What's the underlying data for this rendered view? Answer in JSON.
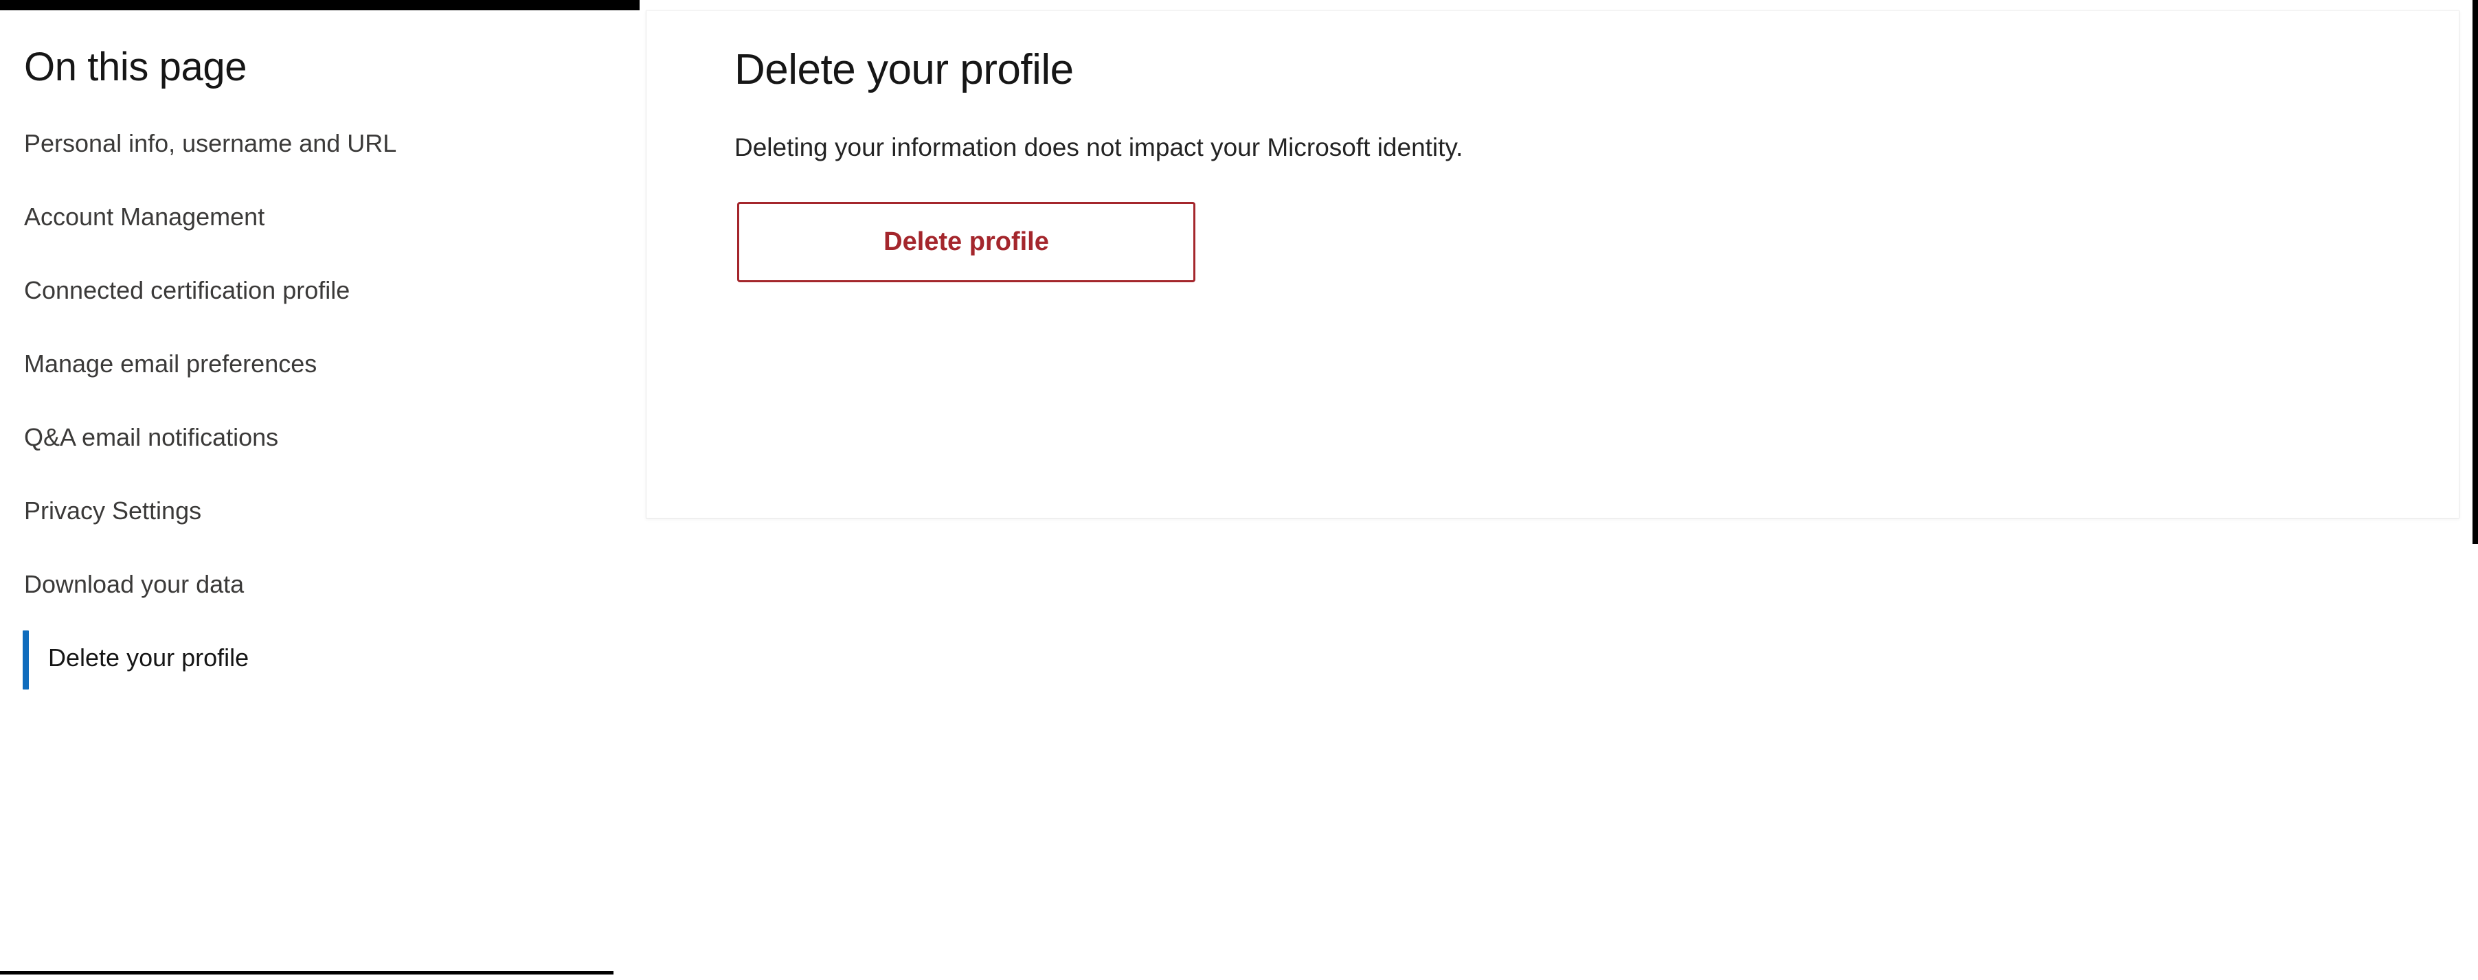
{
  "colors": {
    "accent_blue": "#0F6CBD",
    "danger_red": "#A4262C",
    "text_primary": "#161616",
    "text_secondary": "#3b3a39",
    "card_border": "#ebebeb",
    "black_bar": "#000000"
  },
  "sidebar": {
    "title": "On this page",
    "items": [
      {
        "label": "Personal info, username and URL",
        "active": false
      },
      {
        "label": "Account Management",
        "active": false
      },
      {
        "label": "Connected certification profile",
        "active": false
      },
      {
        "label": "Manage email preferences",
        "active": false
      },
      {
        "label": "Q&A email notifications",
        "active": false
      },
      {
        "label": "Privacy Settings",
        "active": false
      },
      {
        "label": "Download your data",
        "active": false
      },
      {
        "label": "Delete your profile",
        "active": true
      }
    ]
  },
  "main": {
    "heading": "Delete your profile",
    "description": "Deleting your information does not impact your Microsoft identity.",
    "delete_button_label": "Delete profile"
  }
}
